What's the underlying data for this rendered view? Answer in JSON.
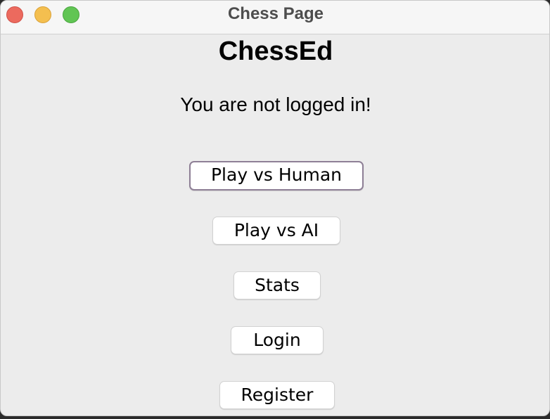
{
  "window": {
    "title": "Chess Page"
  },
  "main": {
    "app_title": "ChessEd",
    "status_text": "You are not logged in!",
    "buttons": {
      "play_human": "Play vs Human",
      "play_ai": "Play vs AI",
      "stats": "Stats",
      "login": "Login",
      "register": "Register"
    }
  },
  "colors": {
    "close": "#ec6a5e",
    "minimize": "#f4bf4f",
    "maximize": "#61c554",
    "focus_ring": "#8e7f96"
  }
}
